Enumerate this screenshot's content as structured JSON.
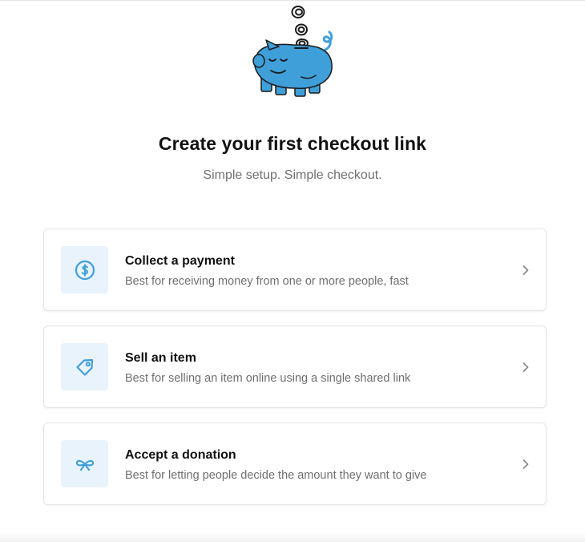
{
  "header": {
    "title": "Create your first checkout link",
    "subtitle": "Simple setup. Simple checkout."
  },
  "colors": {
    "accent": "#3f9fd9",
    "tile_background": "#e9f3fb",
    "text_primary": "#111111",
    "text_secondary": "#6f6f6f"
  },
  "options": [
    {
      "title": "Collect a payment",
      "description": "Best for receiving money from one or more people, fast",
      "icon": "dollar-circle-icon"
    },
    {
      "title": "Sell an item",
      "description": "Best for selling an item online using a single shared link",
      "icon": "price-tag-icon"
    },
    {
      "title": "Accept a donation",
      "description": "Best for letting people decide the amount they want to give",
      "icon": "ribbon-bow-icon"
    }
  ]
}
